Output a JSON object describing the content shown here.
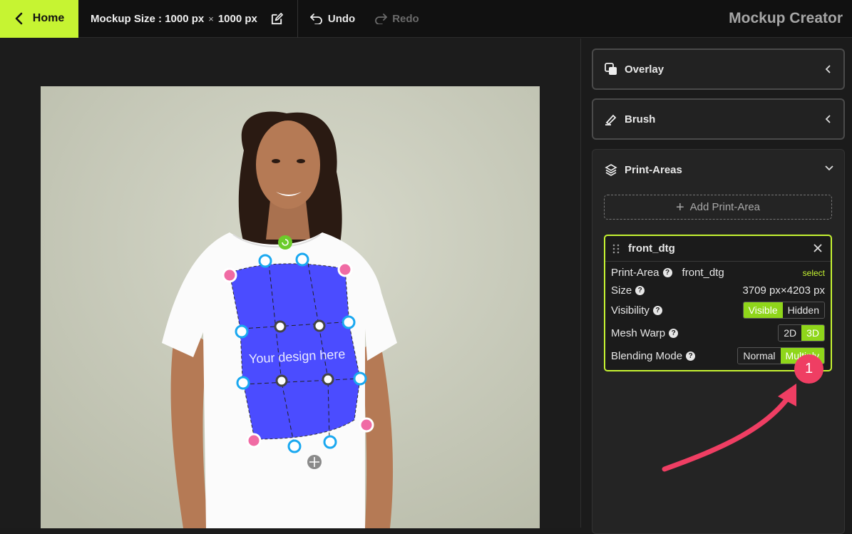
{
  "topbar": {
    "home_label": "Home",
    "mockup_size_label": "Mockup Size :",
    "mockup_width": "1000 px",
    "times": "×",
    "mockup_height": "1000 px",
    "undo_label": "Undo",
    "redo_label": "Redo",
    "app_title": "Mockup Creator"
  },
  "sidebar": {
    "overlay_label": "Overlay",
    "brush_label": "Brush",
    "print_areas_label": "Print-Areas",
    "add_print_area_label": "Add Print-Area",
    "print_area_card": {
      "name": "front_dtg",
      "print_area_label": "Print-Area",
      "print_area_value": "front_dtg",
      "select_label": "select",
      "size_label": "Size",
      "size_value": "3709 px×4203 px",
      "visibility_label": "Visibility",
      "visibility_options": [
        "Visible",
        "Hidden"
      ],
      "visibility_selected": "Visible",
      "mesh_warp_label": "Mesh Warp",
      "mesh_warp_options": [
        "2D",
        "3D"
      ],
      "mesh_warp_selected": "3D",
      "blending_mode_label": "Blending Mode",
      "blending_mode_options": [
        "Normal",
        "Multiply"
      ],
      "blending_mode_selected": "Multiply"
    }
  },
  "canvas": {
    "design_placeholder_text": "Your design here"
  },
  "annotation": {
    "badge_number": "1",
    "badge_color": "#ef3e63"
  },
  "colors": {
    "accent": "#c6f432",
    "print_area_fill": "#4b4cff",
    "corner_handle": "#f06ba4",
    "edge_handle": "#1aa8f0",
    "rotate_handle": "#6ccc2a"
  }
}
